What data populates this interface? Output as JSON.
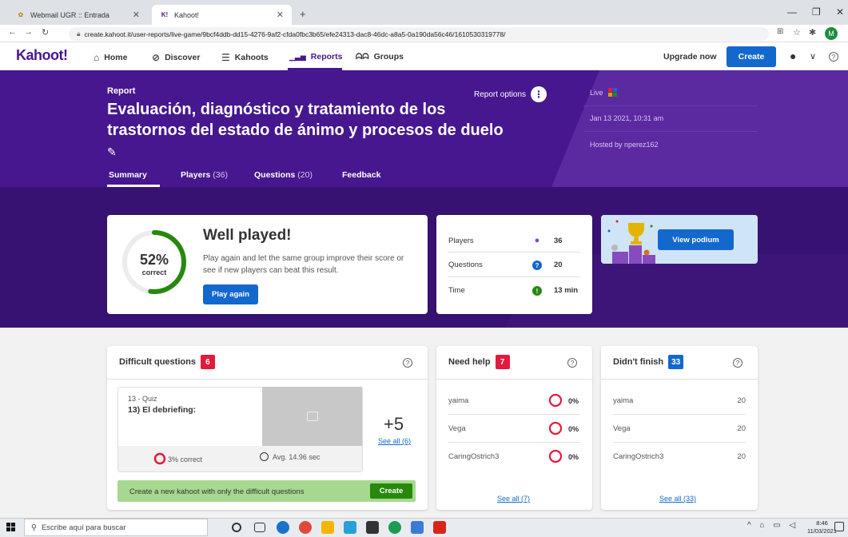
{
  "browser": {
    "tabs": [
      {
        "title": "Webmail UGR :: Entrada",
        "icon": "webmail-icon"
      },
      {
        "title": "Kahoot!",
        "icon": "kahoot-favicon",
        "favicon_text": "K!"
      }
    ],
    "new_tab": "+",
    "url": "create.kahoot.it/user-reports/live-game/9bcf4ddb-dd15-4276-9af2-cfda0fbc3b65/efe24313-dac8-46dc-a8a5-0a190da56c46/1610530319778/",
    "profile_initial": "M"
  },
  "nav": {
    "logo": "Kahoot!",
    "items": [
      {
        "label": "Home",
        "icon": "home-icon",
        "glyph": "⌂"
      },
      {
        "label": "Discover",
        "icon": "compass-icon",
        "glyph": "⊘"
      },
      {
        "label": "Kahoots",
        "icon": "list-icon",
        "glyph": "☰"
      },
      {
        "label": "Reports",
        "icon": "bar-chart-icon",
        "glyph": "▁▃▅"
      },
      {
        "label": "Groups",
        "icon": "group-icon",
        "glyph": "ᗣᗣ"
      }
    ],
    "upgrade": "Upgrade now",
    "create": "Create",
    "help_glyph": "?"
  },
  "report": {
    "label": "Report",
    "title": "Evaluación, diagnóstico y tratamiento de los trastornos del estado de ánimo y procesos de duelo",
    "edit_glyph": "✎",
    "options": "Report options",
    "options_glyph": "⋮",
    "meta": {
      "live": "Live",
      "date": "Jan 13 2021, 10:31 am",
      "host": "Hosted by nperez162"
    },
    "tabs": [
      {
        "label": "Summary",
        "count": ""
      },
      {
        "label": "Players",
        "count": "(36)"
      },
      {
        "label": "Questions",
        "count": "(20)"
      },
      {
        "label": "Feedback",
        "count": ""
      }
    ]
  },
  "summary": {
    "percent": "52%",
    "percent_label": "correct",
    "percent_value": 0.52,
    "title": "Well played!",
    "text": "Play again and let the same group improve their score or see if new players can beat this result.",
    "play_again": "Play again"
  },
  "stats": [
    {
      "label": "Players",
      "value": "36",
      "icon": "player-icon",
      "glyph": "●",
      "color": "#864cbf"
    },
    {
      "label": "Questions",
      "value": "20",
      "icon": "question-icon",
      "glyph": "?",
      "color": "#1368ce"
    },
    {
      "label": "Time",
      "value": "13 min",
      "icon": "clock-icon",
      "glyph": "!",
      "color": "#26890c"
    }
  ],
  "podium": {
    "button": "View podium"
  },
  "difficult": {
    "title": "Difficult questions",
    "count": "6",
    "question_meta": "13 - Quiz",
    "question_name": "13) El debriefing:",
    "correct": "3% correct",
    "avg": "Avg. 14.96 sec",
    "more": "+5",
    "see_all": "See all (6)",
    "banner_text": "Create a new kahoot with only the difficult questions",
    "banner_button": "Create"
  },
  "need_help": {
    "title": "Need help",
    "count": "7",
    "players": [
      {
        "name": "yaima",
        "value": "0%"
      },
      {
        "name": "Vega",
        "value": "0%"
      },
      {
        "name": "CaringOstrich3",
        "value": "0%"
      }
    ],
    "see_all": "See all (7)"
  },
  "didnt_finish": {
    "title": "Didn't finish",
    "count": "33",
    "players": [
      {
        "name": "yaima",
        "value": "20"
      },
      {
        "name": "Vega",
        "value": "20"
      },
      {
        "name": "CaringOstrich3",
        "value": "20"
      }
    ],
    "see_all": "See all (33)"
  },
  "taskbar": {
    "search_placeholder": "Escribe aquí para buscar",
    "time": "8:46",
    "date": "11/03/2021"
  },
  "colors": {
    "purple": "#46178f",
    "blue": "#1368ce",
    "red": "#e21b3c",
    "green": "#26890c"
  }
}
